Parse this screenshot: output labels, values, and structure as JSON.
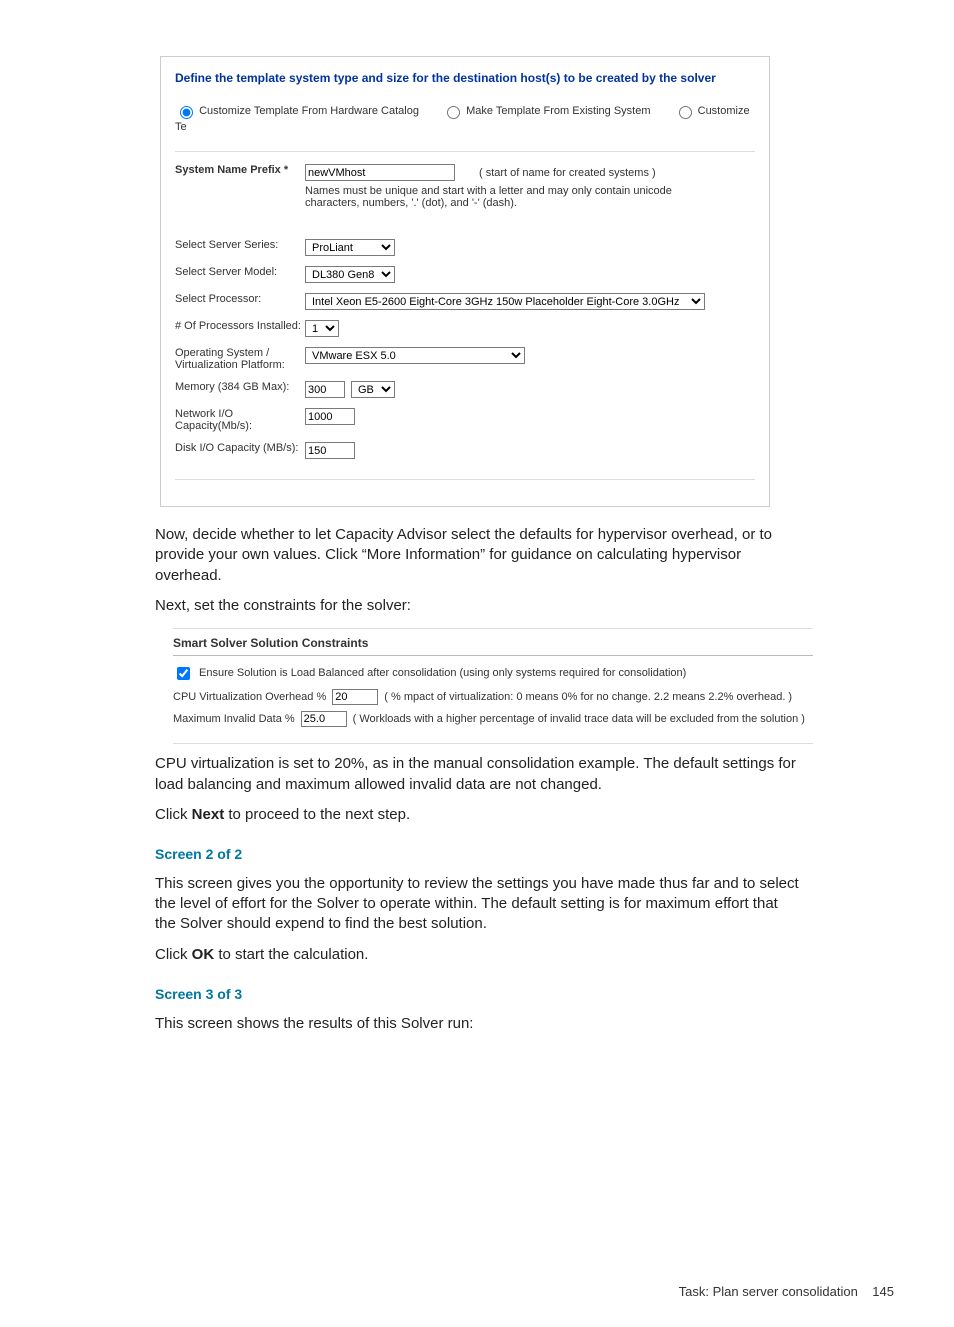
{
  "scr1": {
    "heading": "Define the template system type and size for the destination host(s) to be created by the solver",
    "radios": {
      "r1": "Customize Template From Hardware Catalog",
      "r2": "Make Template From Existing System",
      "r3": "Customize Te"
    },
    "sysname": {
      "label": "System Name Prefix *",
      "value": "newVMhost",
      "note1": "( start of name for created systems )",
      "note2": "Names must be unique and start with a letter and may only contain unicode characters, numbers, '.' (dot), and '-' (dash)."
    },
    "rows": {
      "series": {
        "label": "Select Server Series:",
        "value": "ProLiant"
      },
      "model": {
        "label": "Select Server Model:",
        "value": "DL380 Gen8"
      },
      "proc": {
        "label": "Select Processor:",
        "value": "Intel Xeon E5-2600 Eight-Core 3GHz 150w Placeholder Eight-Core 3.0GHz"
      },
      "numproc": {
        "label": "# Of Processors Installed:",
        "value": "1"
      },
      "os": {
        "label": "Operating System / Virtualization Platform:",
        "value": "VMware ESX 5.0"
      },
      "mem": {
        "label": "Memory (384 GB Max):",
        "value": "300",
        "unit": "GB"
      },
      "netio": {
        "label": "Network I/O Capacity(Mb/s):",
        "value": "1000"
      },
      "diskio": {
        "label": "Disk I/O Capacity (MB/s):",
        "value": "150"
      }
    }
  },
  "para": {
    "p1": "Now, decide whether to let Capacity Advisor select the defaults for hypervisor overhead, or to provide your own values. Click “More Information” for guidance on calculating hypervisor overhead.",
    "p2": "Next, set the constraints for the solver:",
    "p3": "CPU virtualization is set to 20%, as in the manual consolidation example. The default settings for load balancing and maximum allowed invalid data are not changed.",
    "p4a": "Click ",
    "p4b": "Next",
    "p4c": " to proceed to the next step.",
    "s2": "Screen 2 of 2",
    "p5": "This screen gives you the opportunity to review the settings you have made thus far and to select the level of effort for the Solver to operate within. The default setting is for maximum effort that the Solver should expend to find the best solution.",
    "p6a": "Click ",
    "p6b": "OK",
    "p6c": " to start the calculation.",
    "s3": "Screen 3 of 3",
    "p7": "This screen shows the results of this Solver run:"
  },
  "constraints": {
    "title": "Smart Solver Solution Constraints",
    "chkLabel": "Ensure Solution is Load Balanced after consolidation (using only systems required for consolidation)",
    "r1": {
      "label": "CPU Virtualization Overhead %",
      "value": "20",
      "hint": "( % mpact of virtualization: 0 means 0% for no change. 2.2 means 2.2% overhead. )"
    },
    "r2": {
      "label": "Maximum Invalid Data %",
      "value": "25.0",
      "hint": "( Workloads with a higher percentage of invalid trace data will be excluded from the solution )"
    }
  },
  "footer": {
    "task": "Task: Plan server consolidation",
    "page": "145"
  }
}
